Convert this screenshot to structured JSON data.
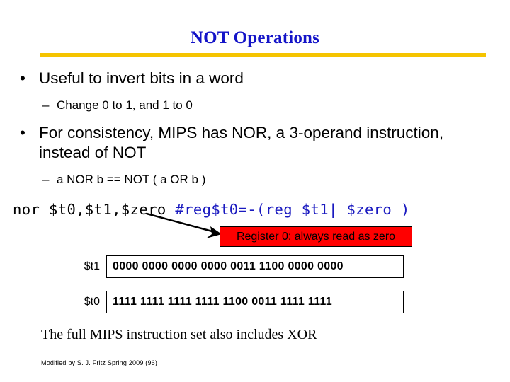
{
  "slide": {
    "title": "NOT Operations",
    "accent_rule_color": "#f5c400",
    "title_color": "#1414c8",
    "bullets": [
      {
        "marker": "•",
        "text": "Useful to invert bits in a word",
        "sub": {
          "marker": "–",
          "text": "Change 0 to 1, and 1 to 0"
        }
      },
      {
        "marker": "•",
        "text": "For consistency, MIPS has NOR, a 3-operand instruction, instead of NOT",
        "sub": {
          "marker": "–",
          "text": "a NOR b == NOT ( a OR b )"
        }
      }
    ],
    "code": {
      "instruction": "nor $t0,$t1,$zero ",
      "comment": "#reg$t0=-(reg $t1| $zero )",
      "comment_color": "#1a1ac0"
    },
    "callout": {
      "text": "Register 0: always read as zero",
      "background": "#ff0000",
      "text_color": "#000000"
    },
    "registers": [
      {
        "label": "$t1",
        "value": "0000 0000 0000 0000 0011 1100 0000 0000"
      },
      {
        "label": "$t0",
        "value": "1111 1111 1111 1111 1100 0011 1111 1111"
      }
    ],
    "closing_note": "The full MIPS instruction set also includes XOR",
    "footer": "Modified by S. J. Fritz  Spring 2009 (96)"
  }
}
